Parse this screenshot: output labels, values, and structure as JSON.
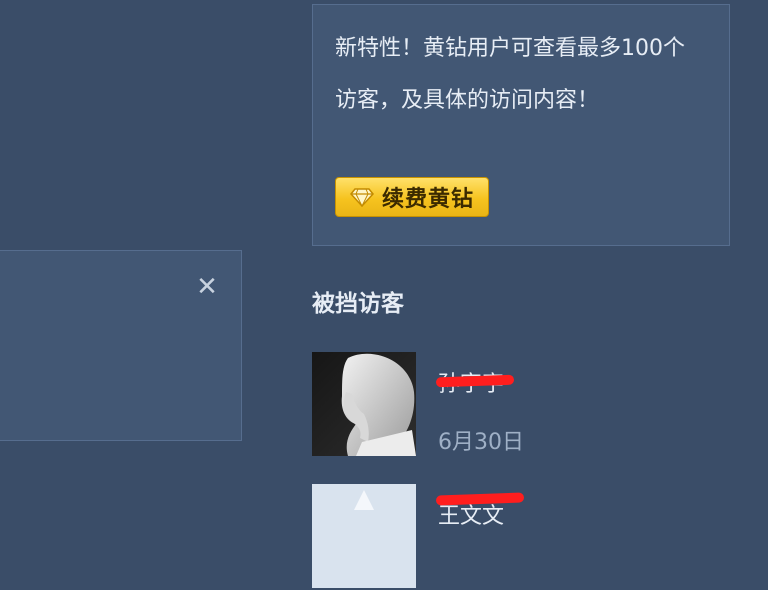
{
  "left_panel": {
    "close_icon": "close-icon"
  },
  "promo": {
    "text": "新特性！黄钻用户可查看最多100个访客，及具体的访问内容！",
    "button_label": "续费黄钻",
    "button_icon": "diamond-icon",
    "accent_color": "#f6c31f"
  },
  "visitors_section": {
    "title": "被挡访客",
    "items": [
      {
        "name": "孙宇宇",
        "date": "6月30日",
        "name_redacted": true
      },
      {
        "name": "王文文",
        "date": "",
        "name_redacted": true
      }
    ]
  }
}
